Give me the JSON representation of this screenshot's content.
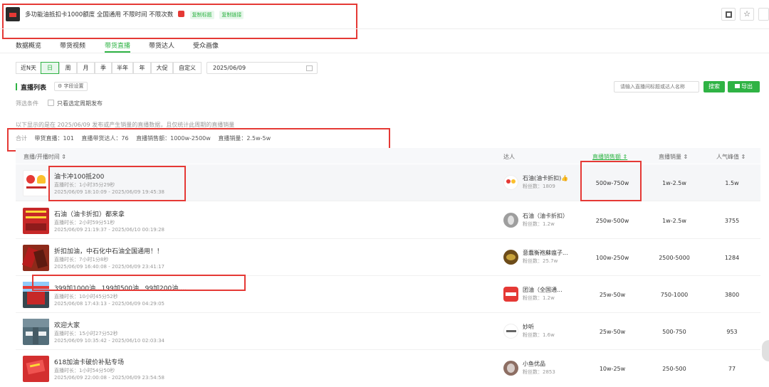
{
  "header": {
    "product_title": "多功能油抵扣卡1000额度 全国通用 不限时间 不限次数",
    "copy_title": "复制标题",
    "copy_link": "复制链接",
    "icon_names": [
      "qrcode-icon",
      "star-icon",
      "doc-icon"
    ]
  },
  "tabs": [
    "数据概览",
    "带货视频",
    "带货直播",
    "带货达人",
    "受众画像"
  ],
  "active_tab": "带货直播",
  "time_filter": {
    "options": [
      "近N天",
      "日",
      "周",
      "月",
      "季",
      "半年",
      "年",
      "大促",
      "自定义"
    ],
    "selected": "日",
    "date": "2025/06/09"
  },
  "list_header": {
    "title": "直播列表",
    "field_settings": "字段设置",
    "search_placeholder": "请输入直播间标题或达人名称",
    "search_button": "搜索",
    "export_button": "导出"
  },
  "filter": {
    "label": "筛选条件",
    "checkbox_label": "只看选定周期发布"
  },
  "notice": "以下显示的是在 2025/06/09 发布或产生销量的直播数据，且仅统计此周期的直播销量",
  "summary": {
    "label": "合计",
    "items": [
      "带货直播：101",
      "直播带货达人：76",
      "直播销售额：1000w-2500w",
      "直播销量：2.5w-5w"
    ]
  },
  "table": {
    "columns": [
      "直播/开播时间 ⇕",
      "达人",
      "直播销售额 ⇕",
      "直播销量 ⇕",
      "人气峰值 ⇕"
    ],
    "rows": [
      {
        "title": "油卡冲100抵200",
        "duration": "直播时长：1小时35分29秒",
        "time": "2025/06/09 18:10:09 - 2025/06/09 19:45:38",
        "influencer": "石油(油卡折扣)👍",
        "fans": "粉丝数：1809",
        "sales": "500w-750w",
        "volume": "1w-2.5w",
        "peak": "1.5w",
        "thumb_color": "#ffffff",
        "avatar_color": "#ffffff"
      },
      {
        "title": "石油（油卡折扣）都来拿",
        "duration": "直播时长：2小时59分51秒",
        "time": "2025/06/09 21:19:37 - 2025/06/10 00:19:28",
        "influencer": "石油（油卡折扣）",
        "fans": "粉丝数：1.2w",
        "sales": "250w-500w",
        "volume": "1w-2.5w",
        "peak": "3755",
        "thumb_color": "#c62828",
        "avatar_color": "#9e9e9e"
      },
      {
        "title": "折扣加油，中石化中石油全国通用！！",
        "duration": "直播时长：7小时1分8秒",
        "time": "2025/06/09 16:40:08 - 2025/06/09 23:41:17",
        "influencer": "意蠢衡袍蘇瘟子...",
        "fans": "粉丝数：25.7w",
        "sales": "100w-250w",
        "volume": "2500-5000",
        "peak": "1284",
        "thumb_color": "#8d2a1a",
        "avatar_color": "#6d4c1a"
      },
      {
        "title": "399加1000油...199加500油...99加200油....",
        "duration": "直播时长：10小时45分52秒",
        "time": "2025/06/08 17:43:13 - 2025/06/09 04:29:05",
        "influencer": "团油（全国通...",
        "fans": "粉丝数：1.2w",
        "sales": "25w-50w",
        "volume": "750-1000",
        "peak": "3800",
        "thumb_color": "#37474f",
        "avatar_color": "#e53935"
      },
      {
        "title": "欢迎大家",
        "duration": "直播时长：15小时27分52秒",
        "time": "2025/06/09 10:35:42 - 2025/06/10 02:03:34",
        "influencer": "妙听",
        "fans": "粉丝数：1.6w",
        "sales": "25w-50w",
        "volume": "500-750",
        "peak": "953",
        "thumb_color": "#546e7a",
        "avatar_color": "#ffffff"
      },
      {
        "title": "618加油卡破价补贴专场",
        "duration": "直播时长：1小时54分50秒",
        "time": "2025/06/09 22:00:08 - 2025/06/09 23:54:58",
        "influencer": "小鱼优品",
        "fans": "粉丝数：2853",
        "sales": "10w-25w",
        "volume": "250-500",
        "peak": "77",
        "thumb_color": "#d32f2f",
        "avatar_color": "#8d6e63"
      }
    ]
  },
  "colors": {
    "accent": "#2fb344",
    "highlight_box": "#e53935"
  }
}
